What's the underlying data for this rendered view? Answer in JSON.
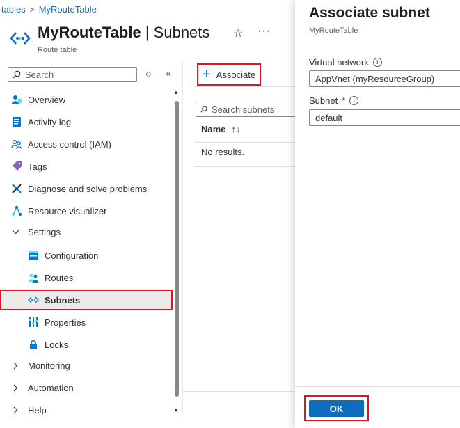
{
  "breadcrumb": {
    "parent": "tables",
    "current": "MyRouteTable"
  },
  "header": {
    "resource_name": "MyRouteTable",
    "section_name": "Subnets",
    "separator": " | ",
    "subtitle": "Route table",
    "favorite_icon": "star-icon",
    "more_icon": "ellipsis-icon"
  },
  "sidebar": {
    "search_placeholder": "Search",
    "items": [
      {
        "label": "Overview",
        "icon": "overview-icon"
      },
      {
        "label": "Activity log",
        "icon": "activity-log-icon"
      },
      {
        "label": "Access control (IAM)",
        "icon": "people-icon"
      },
      {
        "label": "Tags",
        "icon": "tag-icon"
      },
      {
        "label": "Diagnose and solve problems",
        "icon": "wrench-icon"
      },
      {
        "label": "Resource visualizer",
        "icon": "network-icon"
      },
      {
        "label": "Settings",
        "icon": "chevron-down-icon"
      },
      {
        "label": "Configuration",
        "icon": "configuration-icon"
      },
      {
        "label": "Routes",
        "icon": "routes-icon"
      },
      {
        "label": "Subnets",
        "icon": "subnet-icon",
        "selected": true
      },
      {
        "label": "Properties",
        "icon": "properties-icon"
      },
      {
        "label": "Locks",
        "icon": "lock-icon"
      },
      {
        "label": "Monitoring",
        "icon": "chevron-right-icon"
      },
      {
        "label": "Automation",
        "icon": "chevron-right-icon"
      },
      {
        "label": "Help",
        "icon": "chevron-right-icon"
      }
    ]
  },
  "toolbar": {
    "associate_label": "Associate"
  },
  "subnets": {
    "search_placeholder": "Search subnets",
    "column_name": "Name",
    "empty_text": "No results."
  },
  "blade": {
    "title": "Associate subnet",
    "subtitle": "MyRouteTable",
    "vnet_label": "Virtual network",
    "vnet_value": "AppVnet (myResourceGroup)",
    "subnet_label": "Subnet",
    "required_mark": "*",
    "subnet_value": "default",
    "ok_label": "OK"
  },
  "colors": {
    "accent": "#0f6cbd",
    "highlight": "#e81123",
    "selected_bg": "#edebe9"
  }
}
